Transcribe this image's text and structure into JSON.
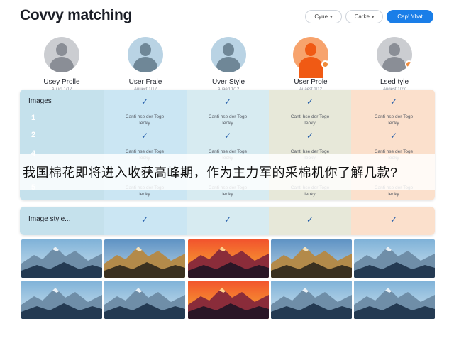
{
  "header": {
    "title": "Covvy matching",
    "btn1_label": "Cyue",
    "btn2_label": "Carke",
    "primary_label": "Cap! Yhat"
  },
  "profiles": [
    {
      "name": "Usey Prolle",
      "sub": "Auuct 1/12",
      "avatar": "gray"
    },
    {
      "name": "User Frale",
      "sub": "Auuect 1/12",
      "avatar": "blue"
    },
    {
      "name": "Uver Style",
      "sub": "Auaed 1/12",
      "avatar": "blue"
    },
    {
      "name": "User Prole",
      "sub": "Auaest 1/12",
      "avatar": "orange"
    },
    {
      "name": "Lsed tyle",
      "sub": "Augest 1/27",
      "avatar": "gray-dot"
    }
  ],
  "matrix": {
    "section_label": "Images",
    "row_numbers": [
      "1",
      "2",
      "4",
      "5"
    ],
    "cell_text": "Canti hse der Toge",
    "cell_sub": "leoky"
  },
  "style_section": {
    "label": "Image style..."
  },
  "overlay_text": "我国棉花即将进入收获高峰期，作为主力军的采棉机你了解几款?",
  "images": {
    "row1": [
      "mountain-blue",
      "mountain-gold",
      "mountain-sunset",
      "mountain-gold",
      "mountain-blue"
    ],
    "row2": [
      "mountain-blue",
      "mountain-blue",
      "mountain-sunset",
      "mountain-blue",
      "mountain-blue"
    ]
  },
  "colors": {
    "accent": "#1a7ee8",
    "check": "#1f5aa8",
    "orange_avatar": "#f05a14"
  }
}
